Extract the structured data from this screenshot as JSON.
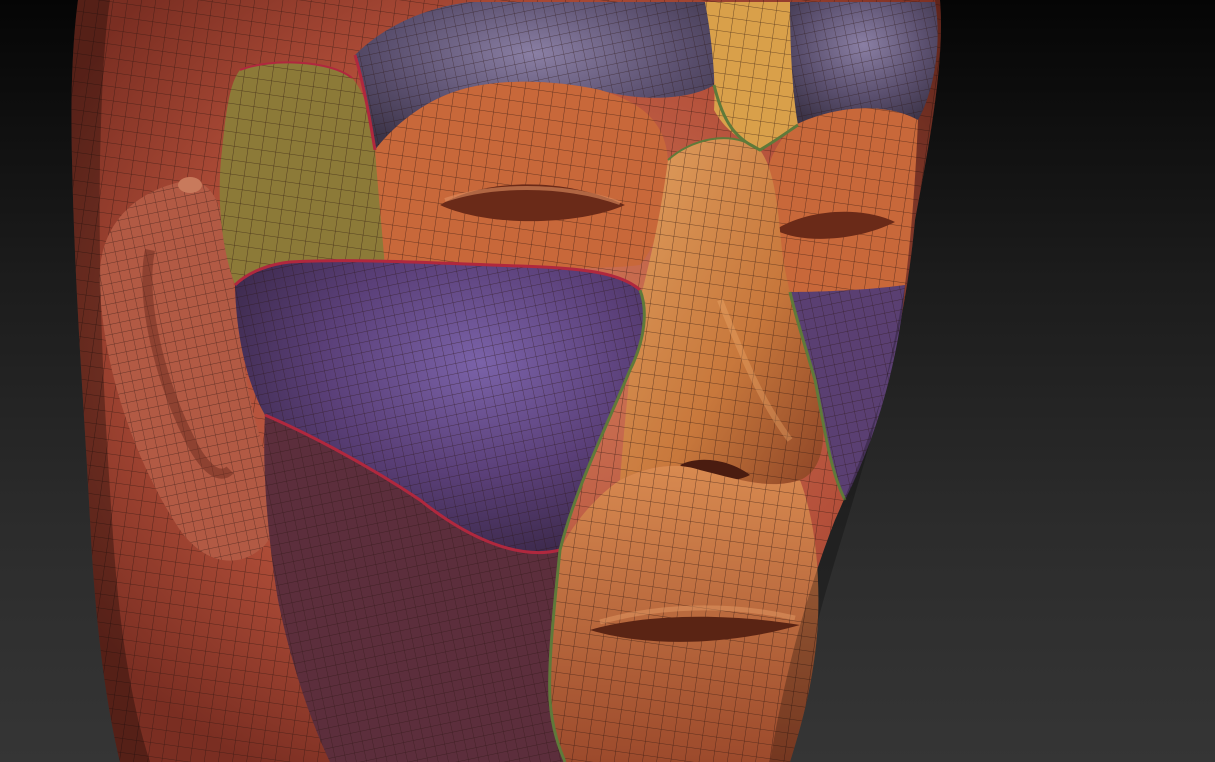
{
  "scene": {
    "subject": "sculpted-head-polygroup-mesh",
    "background_gradient": [
      "#050505",
      "#1b1b1b",
      "#2c2c2c",
      "#353535"
    ],
    "colors": {
      "skin": "#b4503a",
      "skin_dark": "#7a2e22",
      "skin_light": "#d07858",
      "forehead_group": "#5a4f6e",
      "temple_group": "#8c7a38",
      "brow_group": "#c8683a",
      "nose_group": "#d28a4a",
      "nose_bridge_group": "#d9a04a",
      "cheek_group": "#5a3f78",
      "lower_cheek_group": "#5c2e3c",
      "right_cheek_group": "#5a3f72",
      "mouth_group": "#c46a3c",
      "seam_green": "#5f7a3a",
      "seam_red": "#b0283e",
      "wire": "#2a1410"
    }
  }
}
